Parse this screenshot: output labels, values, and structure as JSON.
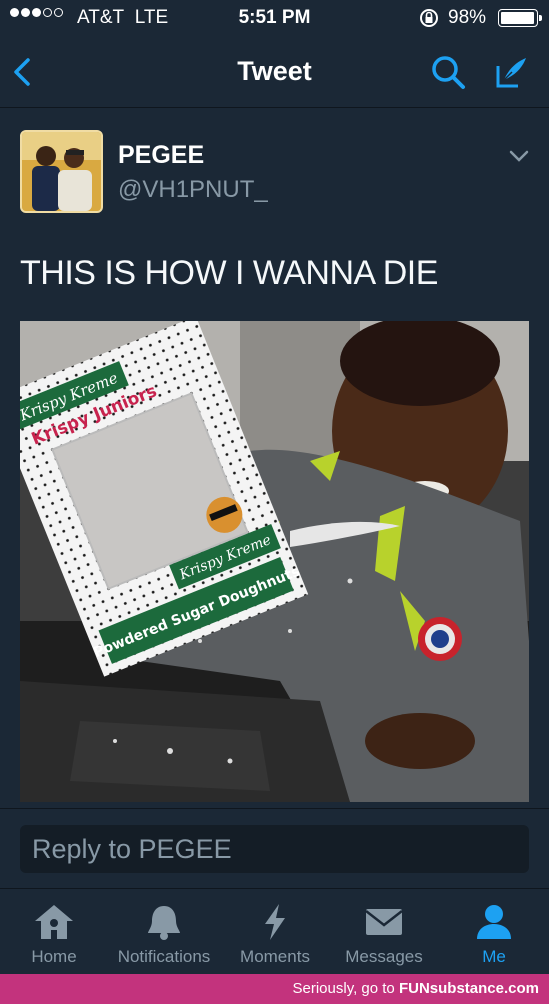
{
  "status_bar": {
    "carrier": "AT&T",
    "network": "LTE",
    "time": "5:51 PM",
    "battery": "98%",
    "battery_level": 0.98
  },
  "nav": {
    "title": "Tweet"
  },
  "tweet": {
    "display_name": "PEGEE",
    "handle": "@VH1PNUT_",
    "text": "THIS IS HOW I WANNA DIE"
  },
  "reply": {
    "placeholder": "Reply to PEGEE"
  },
  "tabs": [
    {
      "label": "Home",
      "icon": "home-icon"
    },
    {
      "label": "Notifications",
      "icon": "bell-icon"
    },
    {
      "label": "Moments",
      "icon": "lightning-icon"
    },
    {
      "label": "Messages",
      "icon": "envelope-icon"
    },
    {
      "label": "Me",
      "icon": "person-icon",
      "active": true
    }
  ],
  "footer": {
    "text": "Seriously, go to",
    "brand": "FUNsubstance.com"
  },
  "colors": {
    "accent": "#1da1f2",
    "background": "#141d26",
    "panel": "#1b2836",
    "muted": "#8899a6",
    "footer": "#c3337d"
  }
}
